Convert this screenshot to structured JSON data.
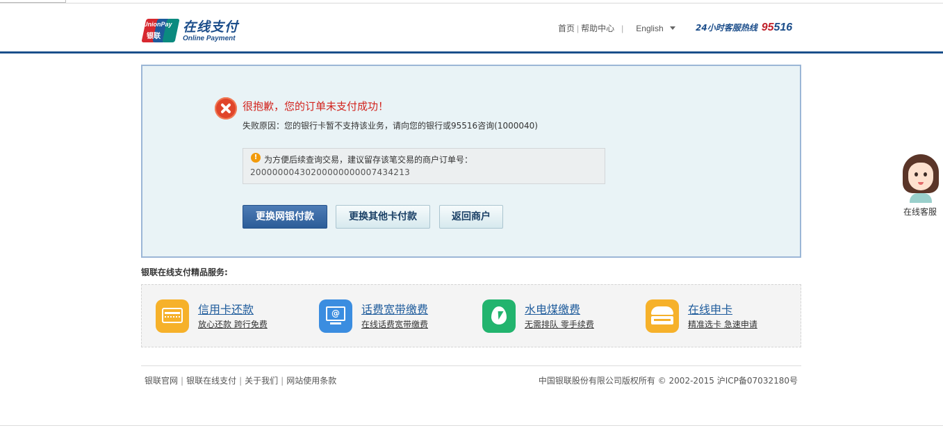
{
  "header": {
    "brand": {
      "mark_line1": "UnionPay",
      "mark_line2": "银联",
      "title": "在线支付",
      "subtitle": "Online Payment"
    },
    "nav": {
      "home": "首页",
      "help": "帮助中心",
      "language": "English"
    },
    "hotline": {
      "label": "24小时客服热线",
      "number_prefix": "95",
      "number_suffix": "516"
    }
  },
  "main": {
    "error": {
      "title": "很抱歉，您的订单未支付成功！",
      "reason": "失败原因：您的银行卡暂不支持该业务，请向您的银行或95516咨询(1000040)"
    },
    "notice": {
      "icon": "!",
      "text": "为方便后续查询交易，建议留存该笔交易的商户订单号：",
      "order_number": "20000000430200000000007434213"
    },
    "buttons": {
      "change_bank": "更换网银付款",
      "change_card": "更换其他卡付款",
      "back_merchant": "返回商户"
    }
  },
  "services": {
    "title": "银联在线支付精品服务:",
    "items": [
      {
        "name": "信用卡还款",
        "desc": "放心还款 跨行免费",
        "icon": "credit-card-icon",
        "color": "#f6b12a"
      },
      {
        "name": "话费宽带缴费",
        "desc": "在线话费宽带缴费",
        "icon": "computer-icon",
        "color": "#3b8de0"
      },
      {
        "name": "水电煤缴费",
        "desc": "无需排队 零手续费",
        "icon": "water-drop-icon",
        "color": "#22b46e"
      },
      {
        "name": "在线申卡",
        "desc": "精准选卡 急速申请",
        "icon": "card-apply-icon",
        "color": "#f6b12a"
      }
    ],
    "icon_pc_text": "@"
  },
  "footer": {
    "links": [
      "银联官网",
      "银联在线支付",
      "关于我们",
      "网站使用条款"
    ],
    "copyright": "中国银联股份有限公司版权所有 © 2002-2015  沪ICP备07032180号"
  },
  "customer_service": {
    "label": "在线客服"
  },
  "colors": {
    "brand_blue": "#1b4d8a",
    "error_red": "#d2241e",
    "panel_bg": "#e9f3f6"
  }
}
